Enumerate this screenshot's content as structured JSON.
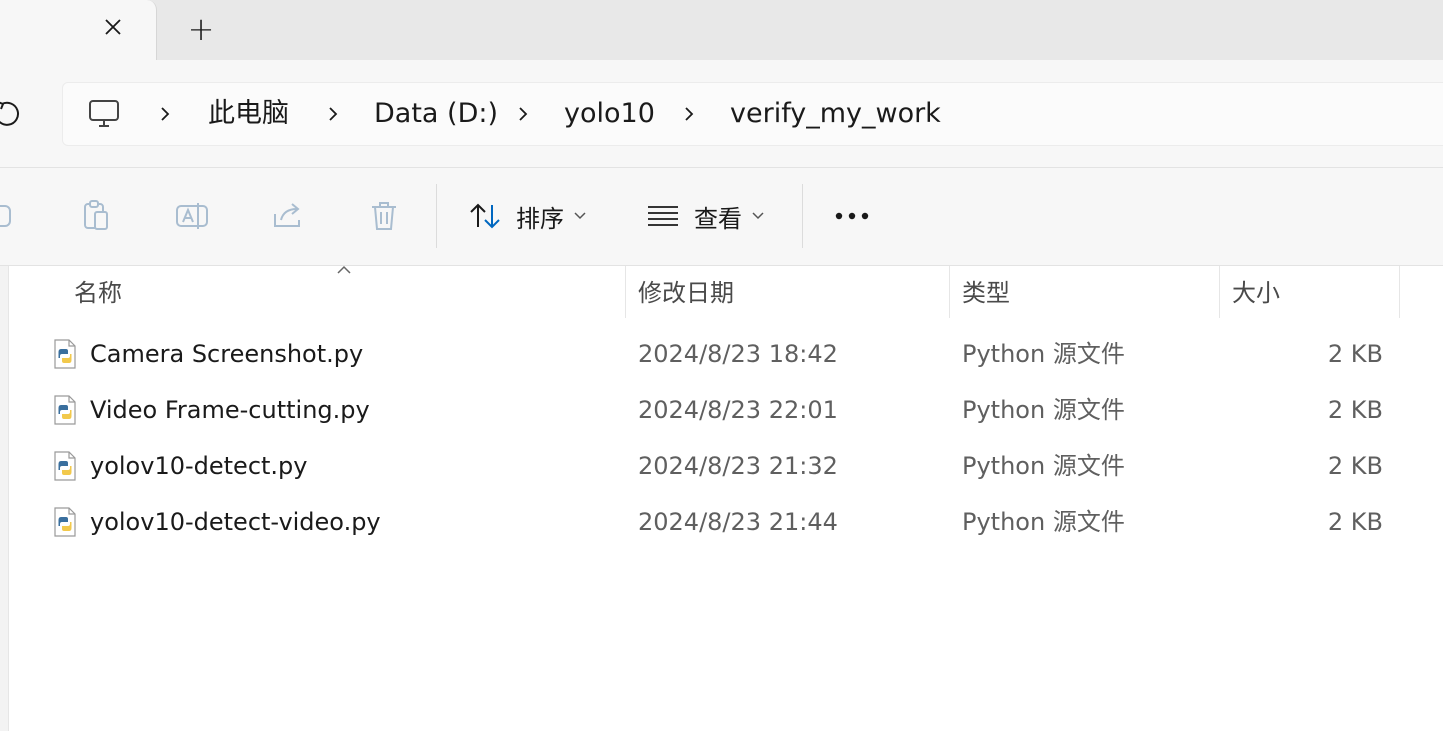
{
  "tabs": {
    "new_tab_symbol": "+"
  },
  "breadcrumb": {
    "root_icon": "monitor-icon",
    "items": [
      "此电脑",
      "Data (D:)",
      "yolo10",
      "verify_my_work"
    ]
  },
  "toolbar": {
    "sort_label": "排序",
    "view_label": "查看"
  },
  "columns": {
    "name": "名称",
    "modified": "修改日期",
    "type": "类型",
    "size": "大小"
  },
  "files": [
    {
      "name": "Camera Screenshot.py",
      "modified": "2024/8/23 18:42",
      "type": "Python 源文件",
      "size": "2 KB"
    },
    {
      "name": "Video Frame-cutting.py",
      "modified": "2024/8/23 22:01",
      "type": "Python 源文件",
      "size": "2 KB"
    },
    {
      "name": "yolov10-detect.py",
      "modified": "2024/8/23 21:32",
      "type": "Python 源文件",
      "size": "2 KB"
    },
    {
      "name": "yolov10-detect-video.py",
      "modified": "2024/8/23 21:44",
      "type": "Python 源文件",
      "size": "2 KB"
    }
  ],
  "colors": {
    "python_blue": "#3a6f9e",
    "python_yellow": "#f2c94c",
    "accent": "#0067c0"
  }
}
